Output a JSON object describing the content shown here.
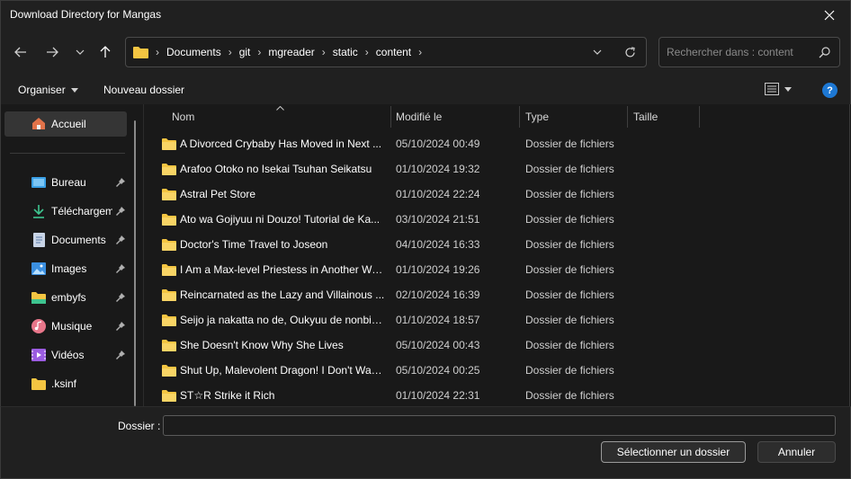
{
  "window": {
    "title": "Download Directory for Mangas"
  },
  "address": {
    "crumbs": [
      "Documents",
      "git",
      "mgreader",
      "static",
      "content"
    ],
    "search_placeholder": "Rechercher dans : content"
  },
  "toolbar": {
    "organize_label": "Organiser",
    "new_folder_label": "Nouveau dossier",
    "help_label": "?"
  },
  "sidebar": {
    "home_label": "Accueil",
    "quick_access": [
      {
        "label": "Bureau",
        "icon": "desktop-icon",
        "pinned": true
      },
      {
        "label": "Téléchargem",
        "icon": "download-icon",
        "pinned": true
      },
      {
        "label": "Documents",
        "icon": "documents-icon",
        "pinned": true
      },
      {
        "label": "Images",
        "icon": "images-icon",
        "pinned": true
      },
      {
        "label": "embyfs",
        "icon": "folder-icon",
        "pinned": true
      },
      {
        "label": "Musique",
        "icon": "music-icon",
        "pinned": true
      },
      {
        "label": "Vidéos",
        "icon": "videos-icon",
        "pinned": true
      },
      {
        "label": ".ksinf",
        "icon": "folder-icon",
        "pinned": false
      }
    ]
  },
  "columns": {
    "name": "Nom",
    "modified": "Modifié le",
    "type": "Type",
    "size": "Taille"
  },
  "files": [
    {
      "name": "A Divorced Crybaby Has Moved in Next ...",
      "modified": "05/10/2024 00:49",
      "type": "Dossier de fichiers"
    },
    {
      "name": "Arafoo Otoko no Isekai Tsuhan Seikatsu",
      "modified": "01/10/2024 19:32",
      "type": "Dossier de fichiers"
    },
    {
      "name": "Astral Pet Store",
      "modified": "01/10/2024 22:24",
      "type": "Dossier de fichiers"
    },
    {
      "name": "Ato wa Gojiyuu ni Douzo! Tutorial de Ka...",
      "modified": "03/10/2024 21:51",
      "type": "Dossier de fichiers"
    },
    {
      "name": "Doctor's Time Travel to Joseon",
      "modified": "04/10/2024 16:33",
      "type": "Dossier de fichiers"
    },
    {
      "name": "I Am a Max-level Priestess in Another Wo...",
      "modified": "01/10/2024 19:26",
      "type": "Dossier de fichiers"
    },
    {
      "name": "Reincarnated as the Lazy and Villainous ...",
      "modified": "02/10/2024 16:39",
      "type": "Dossier de fichiers"
    },
    {
      "name": "Seijo ja nakatta no de, Oukyuu de nonbiri...",
      "modified": "01/10/2024 18:57",
      "type": "Dossier de fichiers"
    },
    {
      "name": "She Doesn't Know Why She Lives",
      "modified": "05/10/2024 00:43",
      "type": "Dossier de fichiers"
    },
    {
      "name": "Shut Up, Malevolent Dragon! I Don't Wan...",
      "modified": "05/10/2024 00:25",
      "type": "Dossier de fichiers"
    },
    {
      "name": "ST☆R  Strike it Rich",
      "modified": "01/10/2024 22:31",
      "type": "Dossier de fichiers"
    }
  ],
  "footer": {
    "folder_label": "Dossier :",
    "folder_value": "",
    "select_label": "Sélectionner un dossier",
    "cancel_label": "Annuler"
  },
  "colors": {
    "background": "#191919",
    "chrome": "#202020",
    "folder": "#f4c542",
    "accent": "#1d78d4"
  }
}
